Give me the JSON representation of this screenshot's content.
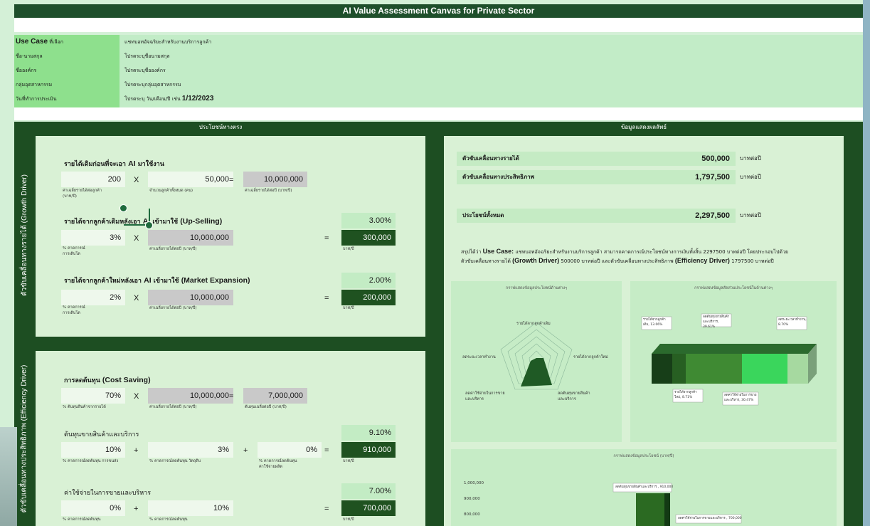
{
  "title": "AI Value Assessment Canvas for Private Sector",
  "info": {
    "rows": [
      {
        "label_en": "Use Case",
        "label": "ที่เลือก",
        "value": "แชทบอทอัจฉริยะสำหรับงานบริการลูกค้า"
      },
      {
        "label": "ชื่อ-นามสกุล",
        "value": "โปรดระบุชื่อนามสกุล"
      },
      {
        "label": "ชื่อองค์กร",
        "value": "โปรดระบุชื่อองค์กร"
      },
      {
        "label": "กลุ่มอุตสาหกรรม",
        "value": "โปรดระบุกลุ่มอุตสาหกรรม"
      },
      {
        "label": "วันที่ทำการประเมิน",
        "value": "โปรดระบุ วัน/เดือน/ปี เช่น",
        "value_big": "1/12/2023"
      }
    ]
  },
  "left_header": "ประโยชน์ทางตรง",
  "right_header": "ข้อมูลแสดงผลลัพธ์",
  "growth_label": "ตัวขับเคลื่อนทางรายได้ (Growth Driver)",
  "efficiency_label": "ตัวขับเคลื่อนทางประสิทธิภาพ (Efficiency Driver)",
  "growth": {
    "base": {
      "title": "รายได้เดิมก่อนที่จะเอา",
      "title_en": "AI",
      "title_tail": "มาใช้งาน",
      "a": "200",
      "a_cap": "ค่าเฉลี่ยรายได้ต่อลูกค้า (บาท/ปี)",
      "op1": "X",
      "b": "50,000",
      "b_cap": "จำนวนลูกค้าทั้งหมด (คน)",
      "op2": "=",
      "c": "10,000,000",
      "c_cap": "ค่าเฉลี่ยรายได้ต่อปี (บาท/ปี)"
    },
    "upsell": {
      "title": "รายได้จากลูกค้าเดิมหลังเอา",
      "title_en": "AI",
      "title_mid": "เข้ามาใช้",
      "title_en2": "(Up-Selling)",
      "pct": "3.00%",
      "a": "3%",
      "a_cap": "% คาดการณ์การเติบโต",
      "op1": "X",
      "b": "10,000,000",
      "b_cap": "ค่าเฉลี่ยรายได้ต่อปี (บาท/ปี)",
      "op2": "=",
      "result": "300,000",
      "result_cap": "บาท/ปี"
    },
    "expansion": {
      "title": "รายได้จากลูกค้าใหม่หลังเอา",
      "title_en": "AI",
      "title_mid": "เข้ามาใช้",
      "title_en2": "(Market Expansion)",
      "pct": "2.00%",
      "a": "2%",
      "a_cap": "% คาดการณ์การเติบโต",
      "op1": "X",
      "b": "10,000,000",
      "b_cap": "ค่าเฉลี่ยรายได้ต่อปี (บาท/ปี)",
      "op2": "=",
      "result": "200,000",
      "result_cap": "บาท/ปี"
    }
  },
  "efficiency": {
    "cost": {
      "title": "การลดต้นทุน",
      "title_en": "(Cost Saving)",
      "a": "70%",
      "a_cap": "% ต้นทุนสินค้าจากรายได้",
      "op1": "X",
      "b": "10,000,000",
      "b_cap": "ค่าเฉลี่ยรายได้ต่อปี (บาท/ปี)",
      "op2": "=",
      "c": "7,000,000",
      "c_cap": "ต้นทุนเฉลี่ยต่อปี (บาท/ปี)"
    },
    "cogs": {
      "title": "ต้นทุนขายสินค้าและบริการ",
      "pct": "9.10%",
      "a": "10%",
      "a_cap": "% คาดการณ์ลดต้นทุน การขนส่ง",
      "op1": "+",
      "b": "3%",
      "b_cap": "% คาดการณ์ลดต้นทุน วัตถุดิบ",
      "op2": "+",
      "c": "0%",
      "c_cap": "% คาดการณ์ลดต้นทุน ค่าใช้จ่ายผลิต",
      "op3": "=",
      "result": "910,000",
      "result_cap": "บาท/ปี"
    },
    "sga": {
      "title": "ค่าใช้จ่ายในการขายและบริหาร",
      "pct": "7.00%",
      "a": "0%",
      "a_cap": "% คาดการณ์ลดต้นทุน",
      "op1": "+",
      "b": "10%",
      "b_cap": "% คาดการณ์ลดต้นทุน",
      "op3": "=",
      "result": "700,000",
      "result_cap": "บาท/ปี"
    }
  },
  "results": {
    "growth": {
      "label": "ตัวขับเคลื่อนทางรายได้",
      "value": "500,000",
      "unit": "บาทต่อปี"
    },
    "efficiency": {
      "label": "ตัวขับเคลื่อนทางประสิทธิภาพ",
      "value": "1,797,500",
      "unit": "บาทต่อปี"
    },
    "total": {
      "label": "ประโยชน์ทั้งหมด",
      "value": "2,297,500",
      "unit": "บาทต่อปี"
    },
    "summary_1a": "สรุปได้ว่า",
    "summary_1b": "Use Case:",
    "summary_1c": "แชทบอทอัจฉริยะสำหรับงานบริการลูกค้า สามารถคาดการณ์ประโยชน์ทางการเงินทั้งสิ้น 2297500 บาทต่อปี โดยประกอบไปด้วย",
    "summary_2a": "ตัวขับเคลื่อนทางรายได้",
    "summary_2b": "(Growth Driver)",
    "summary_2c": "500000",
    "summary_2d": "บาทต่อปี และตัวขับเคลื่อนทางประสิทธิภาพ",
    "summary_2e": "(Efficiency Driver)",
    "summary_2f": "1797500",
    "summary_2g": "บาทต่อปี"
  },
  "charts": {
    "radar_title": "กราฟแสดงข้อมูลประโยชน์ด้านต่างๆ",
    "radar_labels": [
      "รายได้จากลูกค้าเดิม",
      "รายได้จากลูกค้าใหม่",
      "ลดต้นทุนขายสินค้าและบริการ",
      "ลดค่าใช้จ่ายในการขายและบริหาร",
      "ลดระยะเวลาทำงาน"
    ],
    "share_title": "กราฟแสดงข้อมูลสัดส่วนประโยชน์ในด้านต่างๆ",
    "share_labels": [
      "รายได้จากลูกค้าเดิม, 13.06%",
      "ลดต้นทุนขายสินค้าและบริการ, 39.61%",
      "ลดระยะเวลาทำงาน, 8.70%",
      "รายได้จากลูกค้าใหม่, 8.71%",
      "ลดค่าใช้จ่ายในการขายและบริหาร, 30.47%"
    ],
    "bar_title": "กราฟแสดงข้อมูลประโยชน์ (บาท/ปี)",
    "bar_ticks": [
      "1,000,000",
      "900,000",
      "800,000"
    ],
    "bar_label_1": "ลดต้นทุนขายสินค้าและบริการ , 910,000",
    "bar_label_2": "ลดค่าใช้จ่ายในการขายและบริหาร , 700,000"
  }
}
